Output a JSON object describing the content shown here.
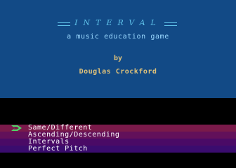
{
  "title": {
    "text": "INTERVAL",
    "color": "#5ec0e8"
  },
  "subtitle": "a music education game",
  "by_label": "by",
  "author": "Douglas Crockford",
  "colors": {
    "title_panel": "#124a86",
    "author_text": "#e0c27a",
    "subtitle_text": "#9ad8ff",
    "pointer": "#4fd86a"
  },
  "menu": {
    "selected_index": 0,
    "pointer_icon": "arrow-pointer-icon",
    "items": [
      {
        "label": "Same/Different"
      },
      {
        "label": "Ascending/Descending"
      },
      {
        "label": "Intervals"
      },
      {
        "label": "Perfect Pitch"
      }
    ]
  }
}
